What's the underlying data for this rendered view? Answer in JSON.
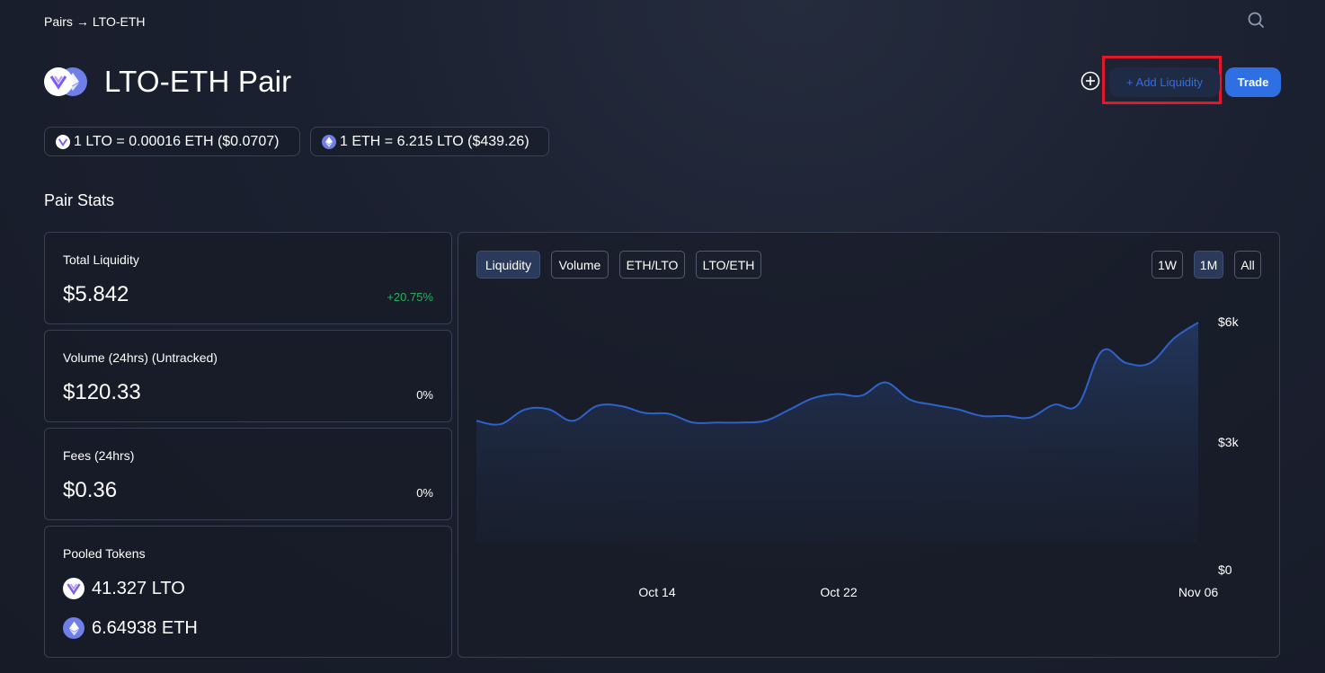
{
  "breadcrumb": {
    "root": "Pairs",
    "separator": "→",
    "current": "LTO-ETH"
  },
  "header": {
    "title": "LTO-ETH Pair",
    "add_liquidity_label": "+ Add Liquidity",
    "trade_label": "Trade"
  },
  "rates": {
    "lto_rate": "1 LTO = 0.00016 ETH ($0.0707)",
    "eth_rate": "1 ETH = 6.215 LTO ($439.26)"
  },
  "section_title": "Pair Stats",
  "stats": {
    "total_liquidity": {
      "label": "Total Liquidity",
      "value": "$5.842",
      "change": "+20.75%"
    },
    "volume": {
      "label": "Volume (24hrs) (Untracked)",
      "value": "$120.33",
      "change": "0%"
    },
    "fees": {
      "label": "Fees (24hrs)",
      "value": "$0.36",
      "change": "0%"
    },
    "pooled": {
      "label": "Pooled Tokens",
      "token1": "41.327 LTO",
      "token2": "6.64938 ETH"
    }
  },
  "chart_tabs": {
    "liquidity": "Liquidity",
    "volume": "Volume",
    "eth_lto": "ETH/LTO",
    "lto_eth": "LTO/ETH"
  },
  "range_tabs": {
    "week": "1W",
    "month": "1M",
    "all": "All"
  },
  "colors": {
    "accent": "#2f6fe4",
    "positive": "#27ae60",
    "line": "#2d63c8",
    "highlight": "#e0182c"
  },
  "chart_data": {
    "type": "area",
    "series": [
      {
        "values": [
          3600,
          3520,
          3870,
          3880,
          3600,
          3960,
          3960,
          3790,
          3770,
          3560,
          3560,
          3560,
          3600,
          3870,
          4150,
          4250,
          4210,
          4530,
          4120,
          3990,
          3880,
          3720,
          3720,
          3680,
          3990,
          3990,
          5290,
          5000,
          5000,
          5600,
          5980
        ]
      }
    ],
    "x_tick_labels": [
      "Oct 14",
      "Oct 22",
      "Nov 06"
    ],
    "y_tick_labels": [
      "$6k",
      "$3k",
      "$0"
    ],
    "ylim": [
      0,
      6000
    ]
  }
}
